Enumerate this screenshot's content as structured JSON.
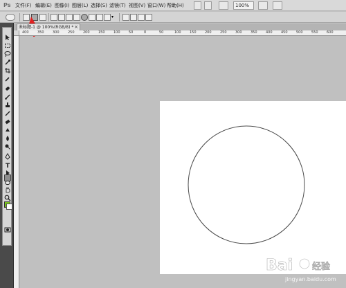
{
  "app": {
    "logo": "Ps"
  },
  "menubar": {
    "items": [
      "文件(F)",
      "编辑(E)",
      "图像(I)",
      "图层(L)",
      "选择(S)",
      "滤镜(T)",
      "视图(V)",
      "窗口(W)",
      "帮助(H)"
    ],
    "zoom": "100%"
  },
  "document": {
    "tab_title": "未标题-1 @ 100%(RGB/8) *",
    "tab_close": "×"
  },
  "ruler": {
    "labels": [
      "400",
      "350",
      "300",
      "250",
      "200",
      "150",
      "100",
      "50",
      "0",
      "50",
      "100",
      "150",
      "200",
      "250",
      "300",
      "350",
      "400",
      "450",
      "500",
      "550",
      "600"
    ]
  },
  "tools": {
    "active": "ellipse-tool",
    "foreground_color": "#77c21a",
    "background_color": "#ffffff"
  },
  "options": {
    "active_mode": "paths-mode"
  },
  "canvas": {
    "background": "#ffffff",
    "shape": "ellipse path"
  },
  "annotation": {
    "arrow_color": "#e02020"
  },
  "watermark": {
    "brand": "Bai",
    "brand_suffix": "经验",
    "url": "jingyan.baidu.com"
  }
}
